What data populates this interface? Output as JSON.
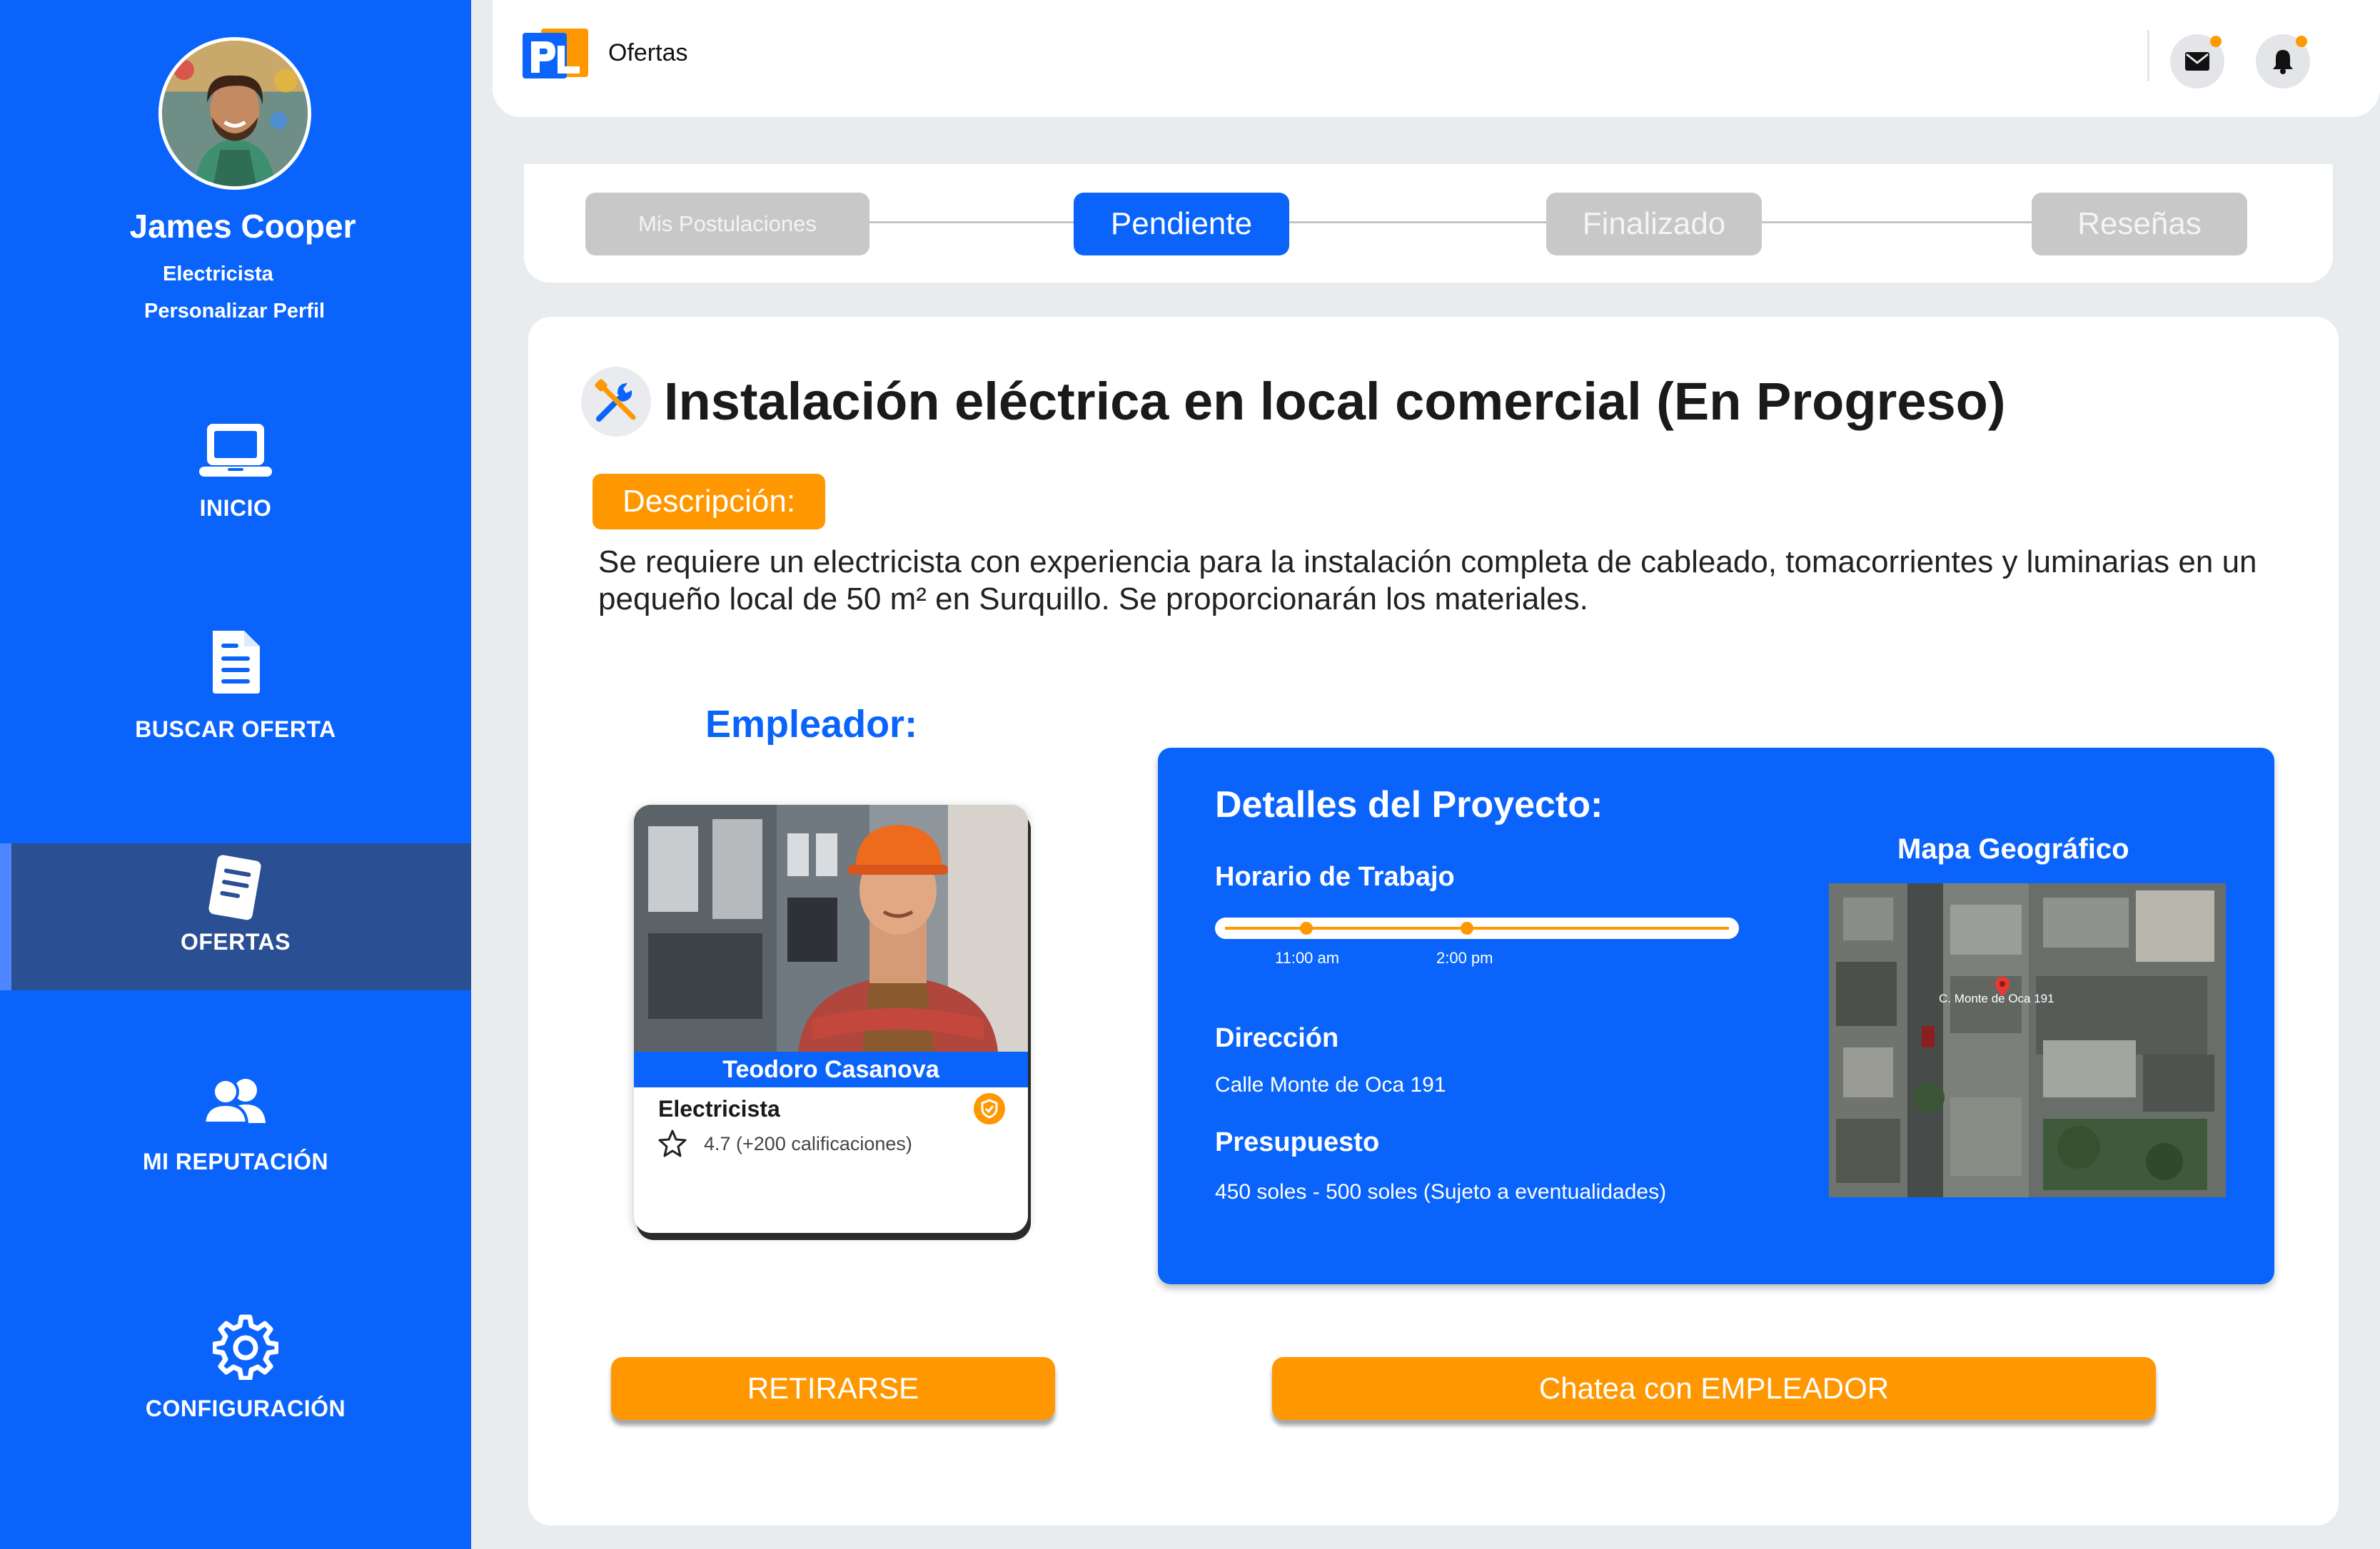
{
  "user": {
    "name": "James Cooper",
    "role": "Electricista",
    "customize": "Personalizar Perfil"
  },
  "nav": [
    {
      "label": "INICIO",
      "icon": "laptop-icon"
    },
    {
      "label": "BUSCAR OFERTA",
      "icon": "document-icon"
    },
    {
      "label": "OFERTAS",
      "icon": "offers-icon",
      "active": true
    },
    {
      "label": "MI REPUTACIÓN",
      "icon": "users-icon"
    },
    {
      "label": "CONFIGURACIÓN",
      "icon": "gear-icon"
    }
  ],
  "header": {
    "title": "Ofertas",
    "logo_text": "PL"
  },
  "tabs": [
    {
      "label": "Mis Postulaciones"
    },
    {
      "label": "Pendiente",
      "active": true
    },
    {
      "label": "Finalizado"
    },
    {
      "label": "Reseñas"
    }
  ],
  "job": {
    "title": "Instalación eléctrica en local comercial (En Progreso)",
    "description_label": "Descripción:",
    "description": "Se requiere un electricista con experiencia para la instalación completa de cableado, tomacorrientes y luminarias en un pequeño local de 50 m² en Surquillo. Se proporcionarán los materiales."
  },
  "employer": {
    "heading": "Empleador:",
    "name": "Teodoro Casanova",
    "role": "Electricista",
    "rating": "4.7 (+200 calificaciones)"
  },
  "details": {
    "title": "Detalles del Proyecto:",
    "schedule_label": "Horario de Trabajo",
    "start_time": "11:00 am",
    "end_time": "2:00 pm",
    "address_label": "Dirección",
    "address": "Calle Monte de Oca 191",
    "budget_label": "Presupuesto",
    "budget": "450 soles - 500 soles (Sujeto a eventualidades)",
    "map_title": "Mapa Geográfico",
    "map_pin_label": "C. Monte de Oca 191"
  },
  "actions": {
    "withdraw": "RETIRARSE",
    "chat": "Chatea con EMPLEADOR"
  },
  "colors": {
    "primary": "#0a64fb",
    "accent": "#ff9800",
    "sidebar_active": "#2a4f93"
  }
}
